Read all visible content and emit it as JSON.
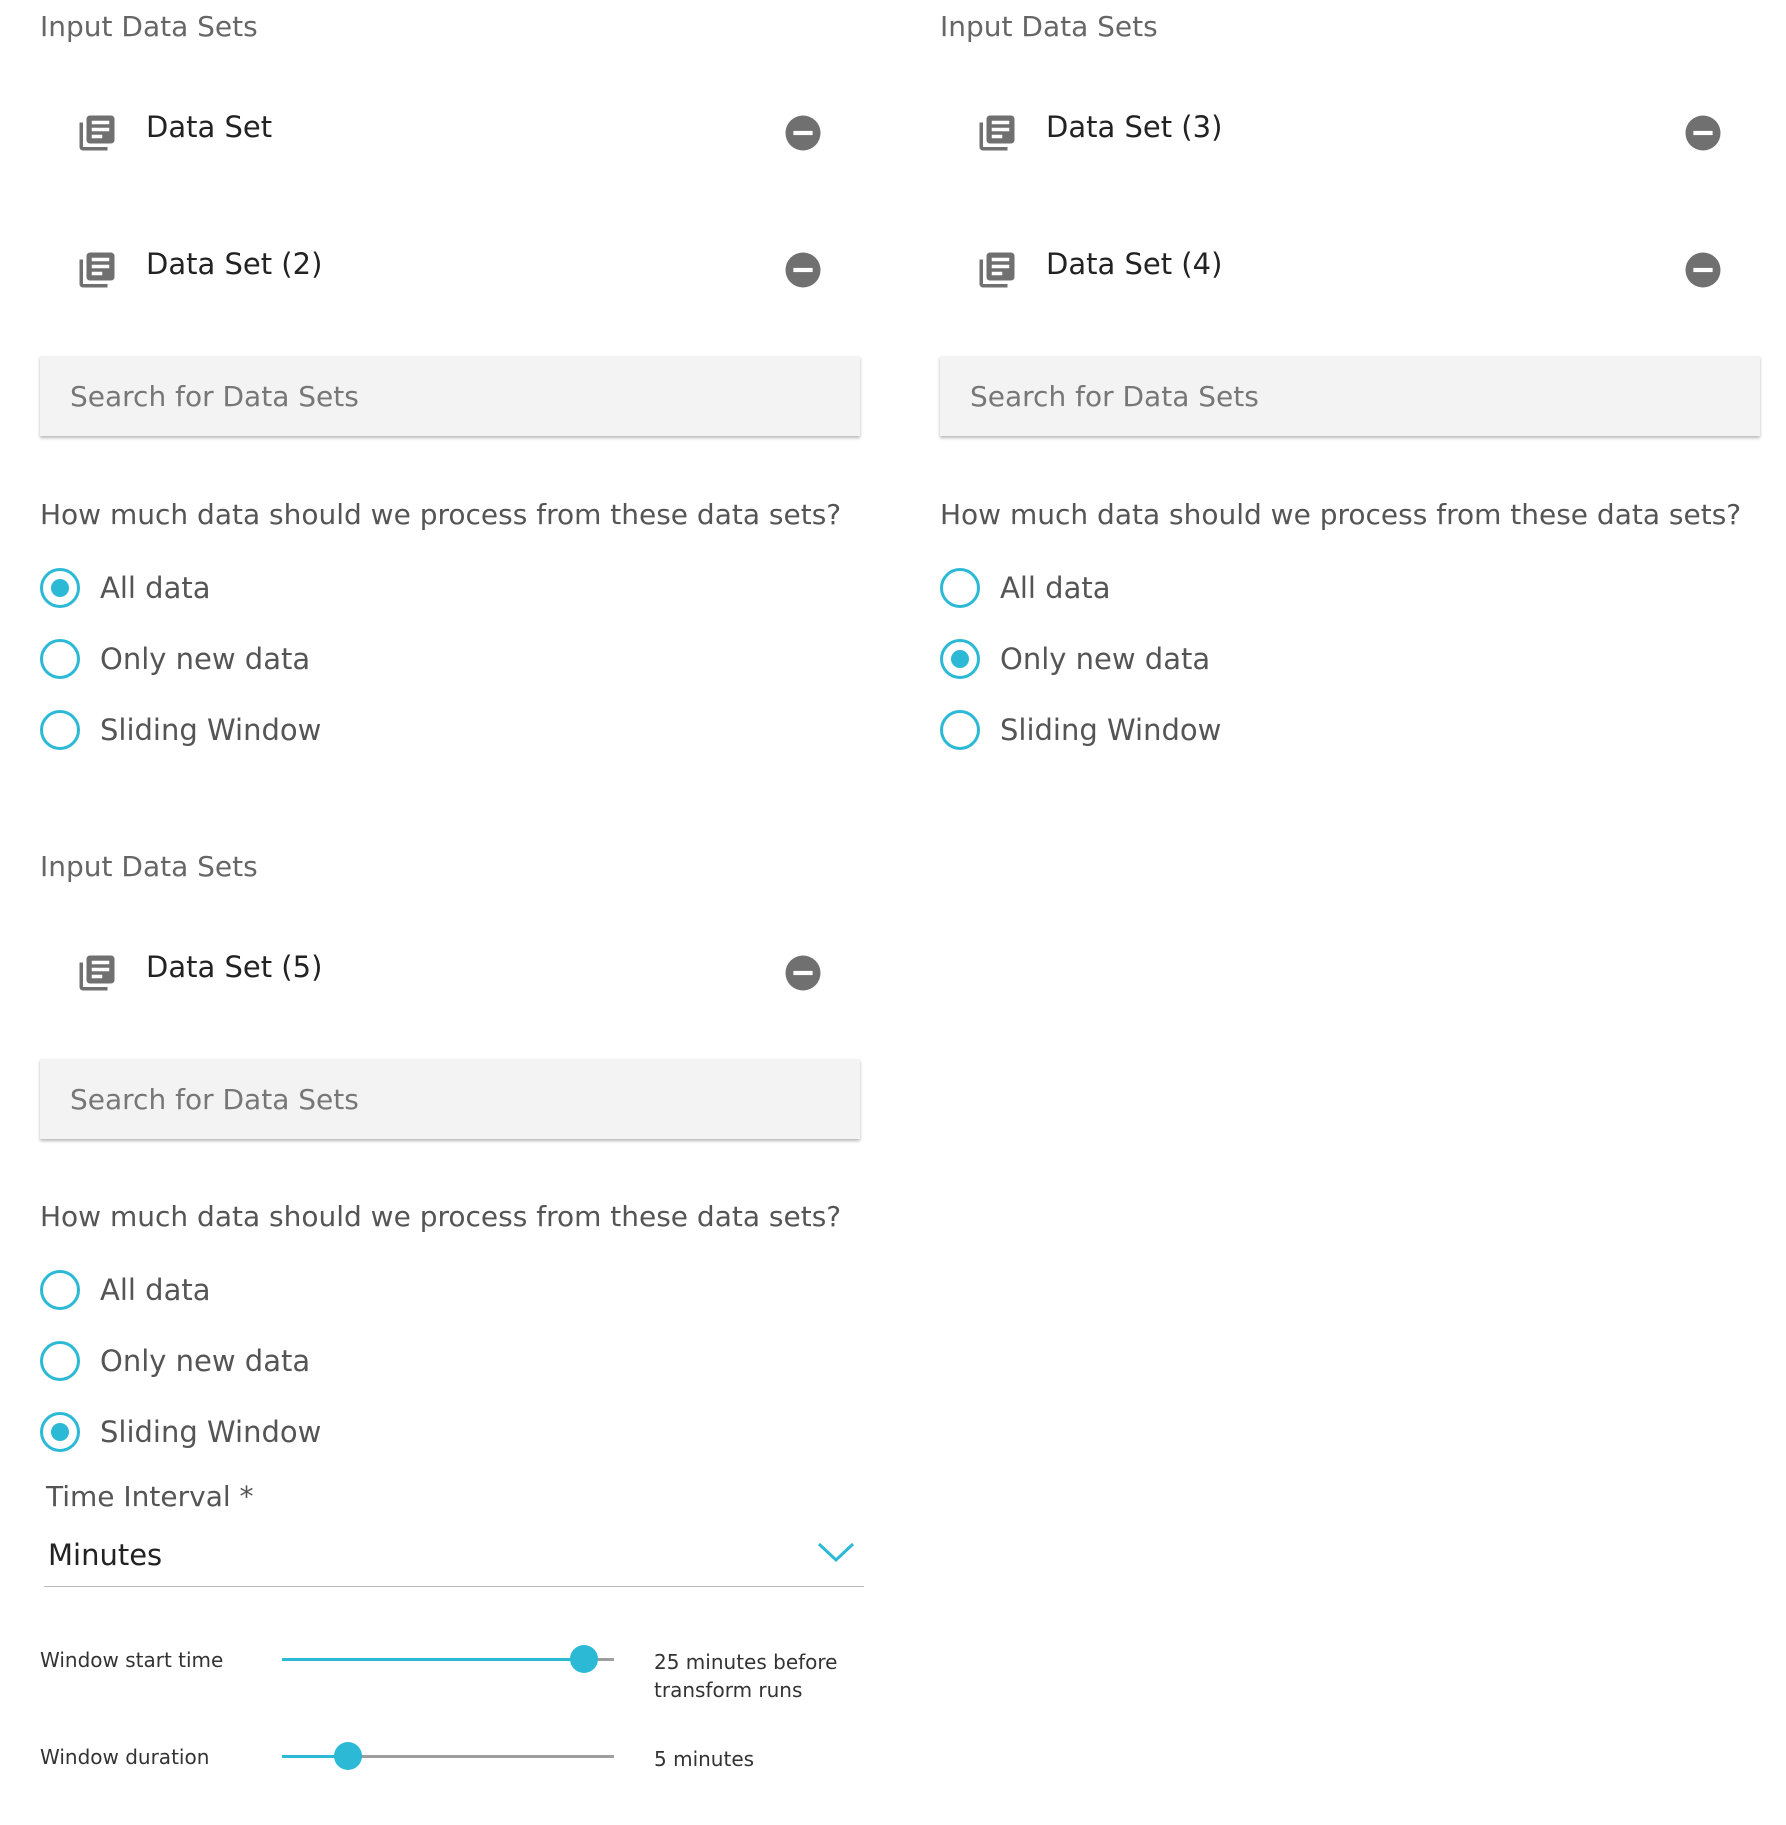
{
  "panels": [
    {
      "title": "Input Data Sets",
      "datasets": [
        {
          "name": "Data Set",
          "icon": "library-books-icon",
          "action_icon": "remove-circle-icon"
        },
        {
          "name": "Data Set (2)",
          "icon": "library-books-icon",
          "action_icon": "remove-circle-icon"
        }
      ],
      "search": {
        "placeholder": "Search for Data Sets",
        "value": ""
      },
      "question": "How much data should we process from these data sets?",
      "options": [
        {
          "label": "All data",
          "selected": true
        },
        {
          "label": "Only new data",
          "selected": false
        },
        {
          "label": "Sliding Window",
          "selected": false
        }
      ]
    },
    {
      "title": "Input Data Sets",
      "datasets": [
        {
          "name": "Data Set (3)",
          "icon": "library-books-icon",
          "action_icon": "remove-circle-icon"
        },
        {
          "name": "Data Set (4)",
          "icon": "library-books-icon",
          "action_icon": "remove-circle-icon"
        }
      ],
      "search": {
        "placeholder": "Search for Data Sets",
        "value": ""
      },
      "question": "How much data should we process from these data sets?",
      "options": [
        {
          "label": "All data",
          "selected": false
        },
        {
          "label": "Only new data",
          "selected": true
        },
        {
          "label": "Sliding Window",
          "selected": false
        }
      ]
    },
    {
      "title": "Input Data Sets",
      "datasets": [
        {
          "name": "Data Set (5)",
          "icon": "library-books-icon",
          "action_icon": "remove-circle-icon"
        }
      ],
      "search": {
        "placeholder": "Search for Data Sets",
        "value": ""
      },
      "question": "How much data should we process from these data sets?",
      "options": [
        {
          "label": "All data",
          "selected": false
        },
        {
          "label": "Only new data",
          "selected": false
        },
        {
          "label": "Sliding Window",
          "selected": true
        }
      ],
      "time_interval": {
        "label": "Time Interval *",
        "value": "Minutes",
        "icon": "chevron-down-icon"
      },
      "sliders": [
        {
          "label": "Window start time",
          "value_text": "25 minutes before transform runs",
          "fraction": 0.91
        },
        {
          "label": "Window duration",
          "value_text": "5 minutes",
          "fraction": 0.2
        }
      ]
    }
  ],
  "colors": {
    "accent": "#2bb9d6",
    "icon": "#707070",
    "search_bg": "#f3f3f3",
    "track": "#9e9e9e",
    "text_primary": "#222222",
    "text_secondary": "#555555"
  }
}
